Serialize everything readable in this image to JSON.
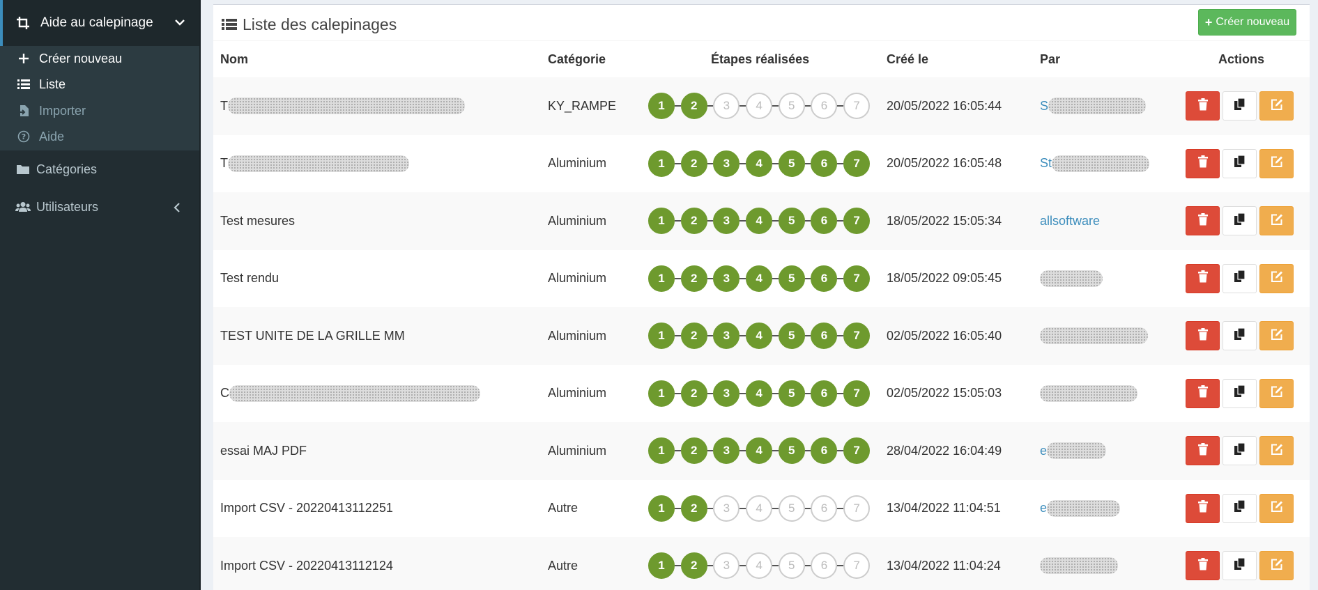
{
  "sidebar": {
    "active_menu": {
      "label": "Aide au calepinage",
      "icon": "crop-icon"
    },
    "submenu": [
      {
        "label": "Créer nouveau",
        "icon": "plus-icon",
        "dim": false
      },
      {
        "label": "Liste",
        "icon": "list-icon",
        "dim": false
      },
      {
        "label": "Importer",
        "icon": "file-import-icon",
        "dim": true
      },
      {
        "label": "Aide",
        "icon": "question-circle-icon",
        "dim": true
      }
    ],
    "items": [
      {
        "label": "Catégories",
        "icon": "folder-icon"
      },
      {
        "label": "Utilisateurs",
        "icon": "users-icon"
      }
    ]
  },
  "box": {
    "title": "Liste des calepinages",
    "new_button": "Créer nouveau"
  },
  "table": {
    "headers": {
      "nom": "Nom",
      "categorie": "Catégorie",
      "etapes": "Étapes réalisées",
      "cree_le": "Créé le",
      "par": "Par",
      "actions": "Actions"
    },
    "total_steps": 7,
    "rows": [
      {
        "nom": "T",
        "nom_redacted": true,
        "categorie": "KY_RAMPE",
        "steps_done": 2,
        "date": "20/05/2022 16:05:44",
        "par": "S",
        "par_redacted": true
      },
      {
        "nom": "T",
        "nom_redacted": true,
        "categorie": "Aluminium",
        "steps_done": 7,
        "date": "20/05/2022 16:05:48",
        "par": "St",
        "par_redacted": true
      },
      {
        "nom": "Test mesures",
        "nom_redacted": false,
        "categorie": "Aluminium",
        "steps_done": 7,
        "date": "18/05/2022 15:05:34",
        "par": "allsoftware",
        "par_redacted": false
      },
      {
        "nom": "Test rendu",
        "nom_redacted": false,
        "categorie": "Aluminium",
        "steps_done": 7,
        "date": "18/05/2022 09:05:45",
        "par": "",
        "par_redacted": true
      },
      {
        "nom": "TEST UNITE DE LA GRILLE MM",
        "nom_redacted": false,
        "categorie": "Aluminium",
        "steps_done": 7,
        "date": "02/05/2022 16:05:40",
        "par": "",
        "par_redacted": true
      },
      {
        "nom": "C",
        "nom_redacted": true,
        "categorie": "Aluminium",
        "steps_done": 7,
        "date": "02/05/2022 15:05:03",
        "par": "",
        "par_redacted": true
      },
      {
        "nom": "essai MAJ PDF",
        "nom_redacted": false,
        "categorie": "Aluminium",
        "steps_done": 7,
        "date": "28/04/2022 16:04:49",
        "par": "e",
        "par_redacted": true
      },
      {
        "nom": "Import CSV - 20220413112251",
        "nom_redacted": false,
        "categorie": "Autre",
        "steps_done": 2,
        "date": "13/04/2022 11:04:51",
        "par": "e",
        "par_redacted": true
      },
      {
        "nom": "Import CSV - 20220413112124",
        "nom_redacted": false,
        "categorie": "Autre",
        "steps_done": 2,
        "date": "13/04/2022 11:04:24",
        "par": "",
        "par_redacted": true
      }
    ],
    "action_icons": [
      "trash-icon",
      "copy-icon",
      "edit-icon"
    ]
  },
  "colors": {
    "sidebar_bg": "#222d32",
    "step_done": "#6e9a2e",
    "btn_success": "#5cb85c",
    "btn_danger": "#dd4b39",
    "btn_warning": "#f0ad4e",
    "link": "#3c8dbc"
  }
}
